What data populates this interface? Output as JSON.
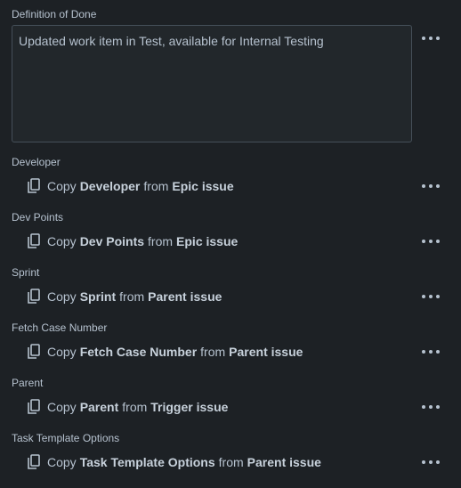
{
  "dod": {
    "label": "Definition of Done",
    "value": "Updated work item in Test, available for Internal Testing"
  },
  "fields": [
    {
      "label": "Developer",
      "copy_word": "Copy",
      "field": "Developer",
      "from_word": "from",
      "source": "Epic issue"
    },
    {
      "label": "Dev Points",
      "copy_word": "Copy",
      "field": "Dev Points",
      "from_word": "from",
      "source": "Epic issue"
    },
    {
      "label": "Sprint",
      "copy_word": "Copy",
      "field": "Sprint",
      "from_word": "from",
      "source": "Parent issue"
    },
    {
      "label": "Fetch Case Number",
      "copy_word": "Copy",
      "field": "Fetch Case Number",
      "from_word": "from",
      "source": "Parent issue"
    },
    {
      "label": "Parent",
      "copy_word": "Copy",
      "field": "Parent",
      "from_word": "from",
      "source": "Trigger issue"
    },
    {
      "label": "Task Template Options",
      "copy_word": "Copy",
      "field": "Task Template Options",
      "from_word": "from",
      "source": "Parent issue"
    }
  ],
  "icons": {
    "more": "more-horizontal-icon",
    "copy": "copy-icon"
  },
  "colors": {
    "background": "#1d2125",
    "text": "#b6c2cf",
    "input_bg": "#22272b",
    "input_border": "#454f59"
  }
}
